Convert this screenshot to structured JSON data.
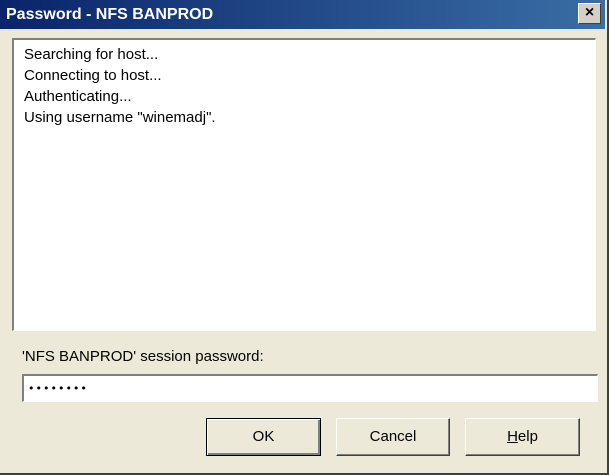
{
  "window": {
    "title": "Password - NFS BANPROD",
    "close_label": "×"
  },
  "log": {
    "lines": [
      "Searching for host...",
      "Connecting to host...",
      "Authenticating...",
      "Using username \"winemadj\"."
    ]
  },
  "prompt": {
    "label": "'NFS BANPROD' session password:",
    "value": "••••••••"
  },
  "buttons": {
    "ok": "OK",
    "cancel": "Cancel",
    "help_first": "H",
    "help_rest": "elp"
  }
}
